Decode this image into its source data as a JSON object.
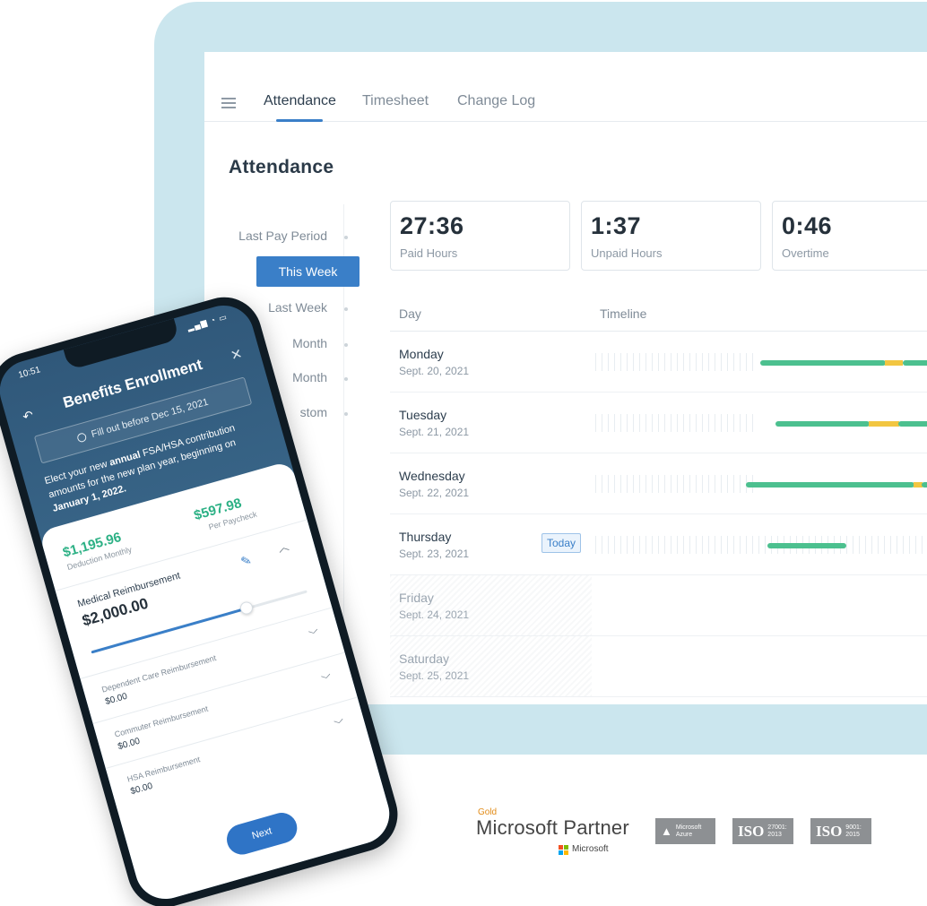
{
  "laptop": {
    "tabs": [
      {
        "label": "Attendance"
      },
      {
        "label": "Timesheet"
      },
      {
        "label": "Change Log"
      }
    ],
    "page_title": "Attendance",
    "periods": [
      {
        "label": "Last Pay Period"
      },
      {
        "label": "This Week"
      },
      {
        "label": "Last Week"
      },
      {
        "label": "Month"
      },
      {
        "label": "Month"
      },
      {
        "label": "stom"
      }
    ],
    "stats": [
      {
        "value": "27:36",
        "label": "Paid Hours"
      },
      {
        "value": "1:37",
        "label": "Unpaid Hours"
      },
      {
        "value": "0:46",
        "label": "Overtime"
      }
    ],
    "table": {
      "headers": {
        "day": "Day",
        "timeline": "Timeline"
      },
      "rows": [
        {
          "day": "Monday",
          "date": "Sept. 20, 2021"
        },
        {
          "day": "Tuesday",
          "date": "Sept. 21, 2021"
        },
        {
          "day": "Wednesday",
          "date": "Sept. 22, 2021"
        },
        {
          "day": "Thursday",
          "date": "Sept. 23, 2021",
          "badge": "Today"
        },
        {
          "day": "Friday",
          "date": "Sept. 24, 2021"
        },
        {
          "day": "Saturday",
          "date": "Sept. 25, 2021"
        }
      ]
    },
    "colors": {
      "accent": "#3a7fc8",
      "worked": "#4cc08f",
      "break": "#f2c641",
      "frame": "#cbe6ee"
    }
  },
  "partners": {
    "gold": "Gold",
    "ms_partner": "Microsoft Partner",
    "ms_word": "Microsoft",
    "azure_line1": "Microsoft",
    "azure_line2": "Azure",
    "iso1": {
      "mark": "ISO",
      "line1": "27001:",
      "line2": "2013"
    },
    "iso2": {
      "mark": "ISO",
      "line1": "9001:",
      "line2": "2015"
    }
  },
  "phone": {
    "time": "10:51",
    "title": "Benefits Enrollment",
    "deadline": "Fill out before Dec 15, 2021",
    "intro_pre": "Elect your new ",
    "intro_bold": "annual",
    "intro_mid": " FSA/HSA contribution amounts for the new plan year, beginning on ",
    "intro_date": "January 1, 2022.",
    "deduction_monthly": {
      "value": "$1,195.96",
      "label": "Deduction Monthly"
    },
    "per_paycheck": {
      "value": "$597.98",
      "label": "Per Paycheck"
    },
    "medical": {
      "title": "Medical Reimbursement",
      "value": "$2,000.00",
      "slider_fraction": 0.72
    },
    "accounts": [
      {
        "title": "Dependent Care Reimbursement",
        "value": "$0.00"
      },
      {
        "title": "Commuter Reimbursement",
        "value": "$0.00"
      },
      {
        "title": "HSA Reimbursement",
        "value": "$0.00"
      }
    ],
    "next_label": "Next"
  }
}
